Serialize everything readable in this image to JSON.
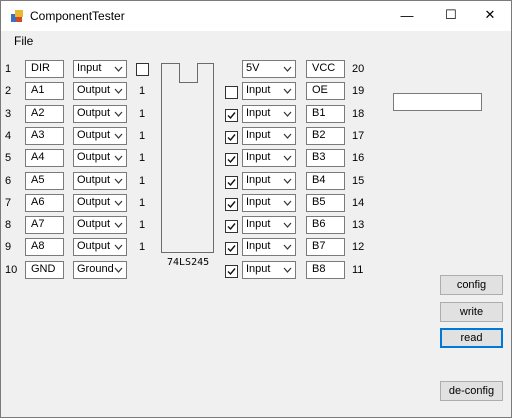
{
  "window": {
    "title": "ComponentTester",
    "minimize_glyph": "—",
    "maximize_glyph": "☐",
    "close_glyph": "✕"
  },
  "menu": {
    "file": "File"
  },
  "left_pins": [
    {
      "pin": "1",
      "name": "DIR",
      "mode": "Input",
      "value": "",
      "checkbox": true
    },
    {
      "pin": "2",
      "name": "A1",
      "mode": "Output",
      "value": "1"
    },
    {
      "pin": "3",
      "name": "A2",
      "mode": "Output",
      "value": "1"
    },
    {
      "pin": "4",
      "name": "A3",
      "mode": "Output",
      "value": "1"
    },
    {
      "pin": "5",
      "name": "A4",
      "mode": "Output",
      "value": "1"
    },
    {
      "pin": "6",
      "name": "A5",
      "mode": "Output",
      "value": "1"
    },
    {
      "pin": "7",
      "name": "A6",
      "mode": "Output",
      "value": "1"
    },
    {
      "pin": "8",
      "name": "A7",
      "mode": "Output",
      "value": "1"
    },
    {
      "pin": "9",
      "name": "A8",
      "mode": "Output",
      "value": "1"
    },
    {
      "pin": "10",
      "name": "GND",
      "mode": "Ground",
      "value": ""
    }
  ],
  "right_pins": [
    {
      "pin": "20",
      "name": "VCC",
      "mode": "5V",
      "checkbox": null
    },
    {
      "pin": "19",
      "name": "OE",
      "mode": "Input",
      "checkbox": false
    },
    {
      "pin": "18",
      "name": "B1",
      "mode": "Input",
      "checkbox": true
    },
    {
      "pin": "17",
      "name": "B2",
      "mode": "Input",
      "checkbox": true
    },
    {
      "pin": "16",
      "name": "B3",
      "mode": "Input",
      "checkbox": true
    },
    {
      "pin": "15",
      "name": "B4",
      "mode": "Input",
      "checkbox": true
    },
    {
      "pin": "14",
      "name": "B5",
      "mode": "Input",
      "checkbox": true
    },
    {
      "pin": "13",
      "name": "B6",
      "mode": "Input",
      "checkbox": true
    },
    {
      "pin": "12",
      "name": "B7",
      "mode": "Input",
      "checkbox": true
    },
    {
      "pin": "11",
      "name": "B8",
      "mode": "Input",
      "checkbox": true
    }
  ],
  "dir_checkbox": false,
  "chip": {
    "label": "74LS245"
  },
  "side_textbox": {
    "value": ""
  },
  "buttons": {
    "config": "config",
    "write": "write",
    "read": "read",
    "deconfig": "de-config"
  },
  "colors": {
    "focus": "#0078d7",
    "face": "#f0f0f0",
    "button": "#e1e1e1"
  }
}
